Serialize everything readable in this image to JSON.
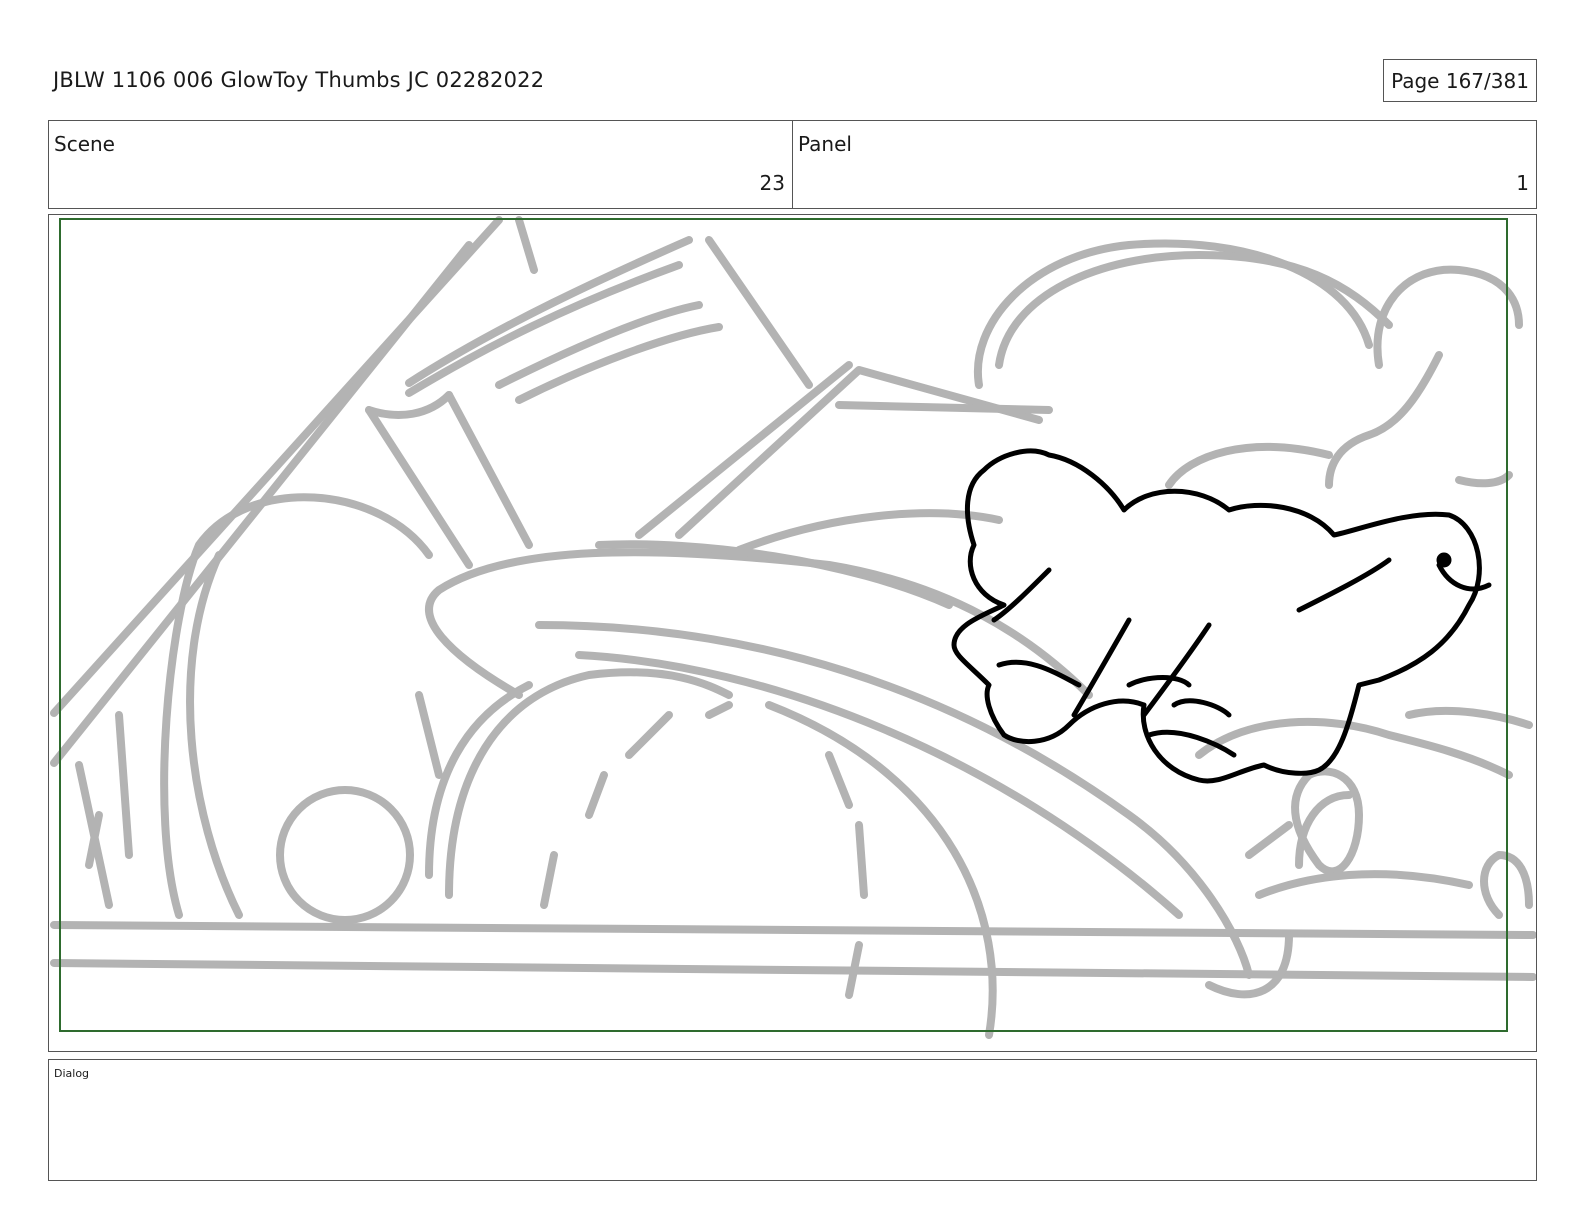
{
  "header": {
    "title": "JBLW 1106 006 GlowToy Thumbs JC 02282022",
    "page": "Page 167/381"
  },
  "meta": {
    "scene_label": "Scene",
    "scene_value": "23",
    "panel_label": "Panel",
    "panel_value": "1"
  },
  "frame": {
    "sketch_color": "#b3b3b3",
    "ink_color": "#000000",
    "safe_frame_color": "#2e6b2e"
  },
  "dialog": {
    "label": "Dialog"
  }
}
